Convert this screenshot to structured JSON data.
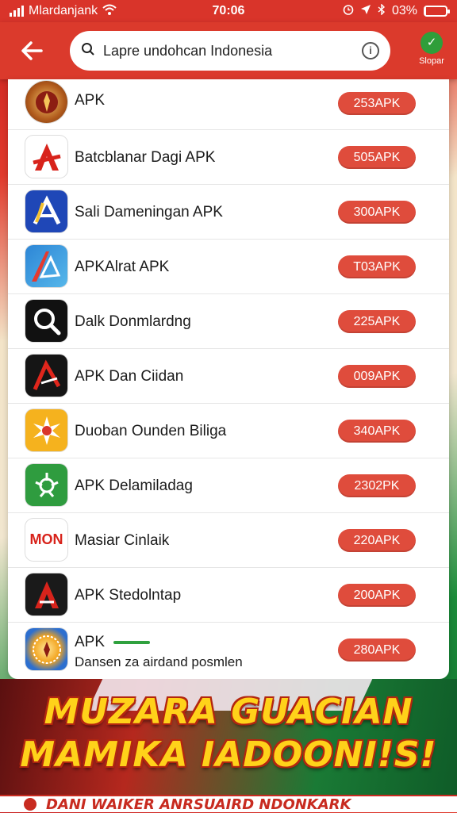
{
  "status_bar": {
    "carrier": "Mlardanjank",
    "time": "70:06",
    "battery": "03%",
    "battery_level": 0.03
  },
  "header": {
    "search_value": "Lapre undohcan Indonesia",
    "shop_label": "Slopar"
  },
  "apps": [
    {
      "name": "APK",
      "button": "253APK",
      "icon": "emblem-icon"
    },
    {
      "name": "Batcblanar Dagi APK",
      "button": "505APK",
      "icon": "letter-a-icon"
    },
    {
      "name": "Sali Dameningan APK",
      "button": "300APK",
      "icon": "arrow-a-icon"
    },
    {
      "name": "APKAlrat APK",
      "button": "T03APK",
      "icon": "blue-a-icon"
    },
    {
      "name": "Dalk Donmlardng",
      "button": "225APK",
      "icon": "magnifier-icon"
    },
    {
      "name": "APK Dan Ciidan",
      "button": "009APK",
      "icon": "red-a-icon"
    },
    {
      "name": "Duoban Ounden Biliga",
      "button": "340APK",
      "icon": "sun-icon"
    },
    {
      "name": "APK Delamiladag",
      "button": "2302PK",
      "icon": "garuda-icon"
    },
    {
      "name": "Masiar Cinlaik",
      "button": "220APK",
      "icon": "mon-logo-icon",
      "icon_text": "MON"
    },
    {
      "name": "APK Stedolntap",
      "button": "200APK",
      "icon": "dark-a-icon"
    },
    {
      "name": "APK",
      "badge": "",
      "subtitle": "Dansen za airdand posmlen",
      "button": "280APK",
      "icon": "seal-icon"
    }
  ],
  "banner": {
    "line1": "MUZARA GUACIAN",
    "line2": "MAMIKA IADOONI!S!",
    "bottom_text": "DANI WAIKER ANRSUAIRD NDONKARK"
  },
  "colors": {
    "accent_red": "#db3a2c",
    "button_red": "#df4c3c",
    "banner_yellow": "#ffd21a",
    "green": "#2fa13e"
  }
}
